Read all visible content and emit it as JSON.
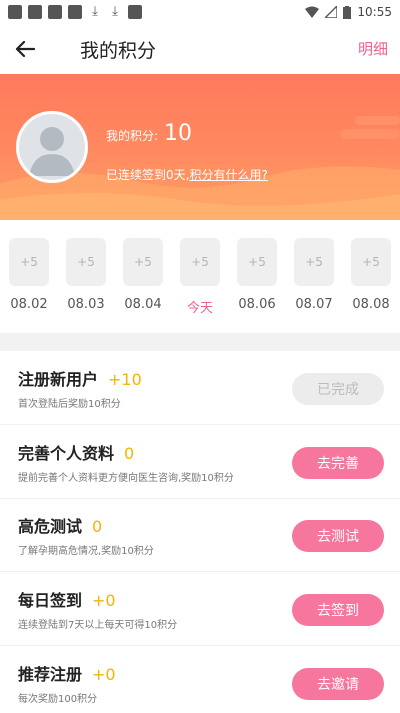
{
  "status_bar": {
    "time": "10:55"
  },
  "header": {
    "title": "我的积分",
    "detail_link": "明细"
  },
  "profile": {
    "points_label": "我的积分:",
    "points_value": "10",
    "checkin_text": "已连续签到0天,",
    "checkin_link": "积分有什么用?"
  },
  "days": [
    {
      "reward": "+5",
      "label": "08.02",
      "today": false
    },
    {
      "reward": "+5",
      "label": "08.03",
      "today": false
    },
    {
      "reward": "+5",
      "label": "08.04",
      "today": false
    },
    {
      "reward": "+5",
      "label": "今天",
      "today": true
    },
    {
      "reward": "+5",
      "label": "08.06",
      "today": false
    },
    {
      "reward": "+5",
      "label": "08.07",
      "today": false
    },
    {
      "reward": "+5",
      "label": "08.08",
      "today": false
    }
  ],
  "tasks": [
    {
      "title": "注册新用户",
      "points": "+10",
      "desc": "首次登陆后奖励10积分",
      "button": "已完成",
      "done": true
    },
    {
      "title": "完善个人资料",
      "points": "0",
      "desc": "提前完善个人资料更方便向医生咨询,奖励10积分",
      "button": "去完善",
      "done": false
    },
    {
      "title": "高危测试",
      "points": "0",
      "desc": "了解孕期高危情况,奖励10积分",
      "button": "去测试",
      "done": false
    },
    {
      "title": "每日签到",
      "points": "+0",
      "desc": "连续登陆到7天以上每天可得10积分",
      "button": "去签到",
      "done": false
    },
    {
      "title": "推荐注册",
      "points": "+0",
      "desc": "每次奖励100积分",
      "button": "去邀请",
      "done": false
    }
  ],
  "colors": {
    "accent": "#f06292",
    "banner": "#ff8a60",
    "points": "#f4b400",
    "button": "#f7769e"
  }
}
